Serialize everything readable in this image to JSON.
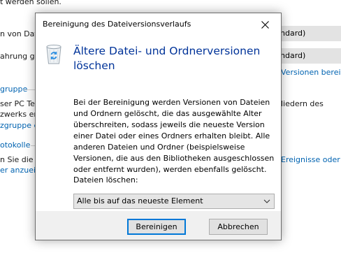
{
  "background": {
    "lines": [
      "t werden sollen.",
      "n von Dat",
      "ahrung ge",
      "gruppe",
      "ser PC Teil",
      "zwerks en",
      "zgruppe e",
      "otokolle",
      "n Sie die",
      "er anzuei"
    ],
    "combo1_value": "ndard)",
    "combo2_value": "ndard)",
    "link1": "Versionen berei",
    "right_text": "liedern des",
    "link2": "Ereignisse oder"
  },
  "dialog": {
    "title": "Bereinigung des Dateiversionsverlaufs",
    "heading": "Ältere Datei- und Ordnerversionen löschen",
    "body": "Bei der Bereinigung werden Versionen von Dateien und Ordnern gelöscht, die das ausgewählte Alter überschreiten, sodass jeweils die neueste Version einer Datei oder eines Ordners erhalten bleibt. Alle anderen Dateien und Ordner (beispielsweise Versionen, die aus den Bibliotheken ausgeschlossen oder entfernt wurden), werden ebenfalls gelöscht.",
    "delete_label": "Dateien löschen:",
    "delete_option": "Alle bis auf das neueste Element",
    "buttons": {
      "cleanup": "Bereinigen",
      "cancel": "Abbrechen"
    }
  },
  "colors": {
    "heading": "#003399",
    "link": "#0063b1",
    "focus": "#0078d7"
  },
  "icons": [
    "recycle-bin-icon",
    "close-icon",
    "chevron-down-icon"
  ]
}
